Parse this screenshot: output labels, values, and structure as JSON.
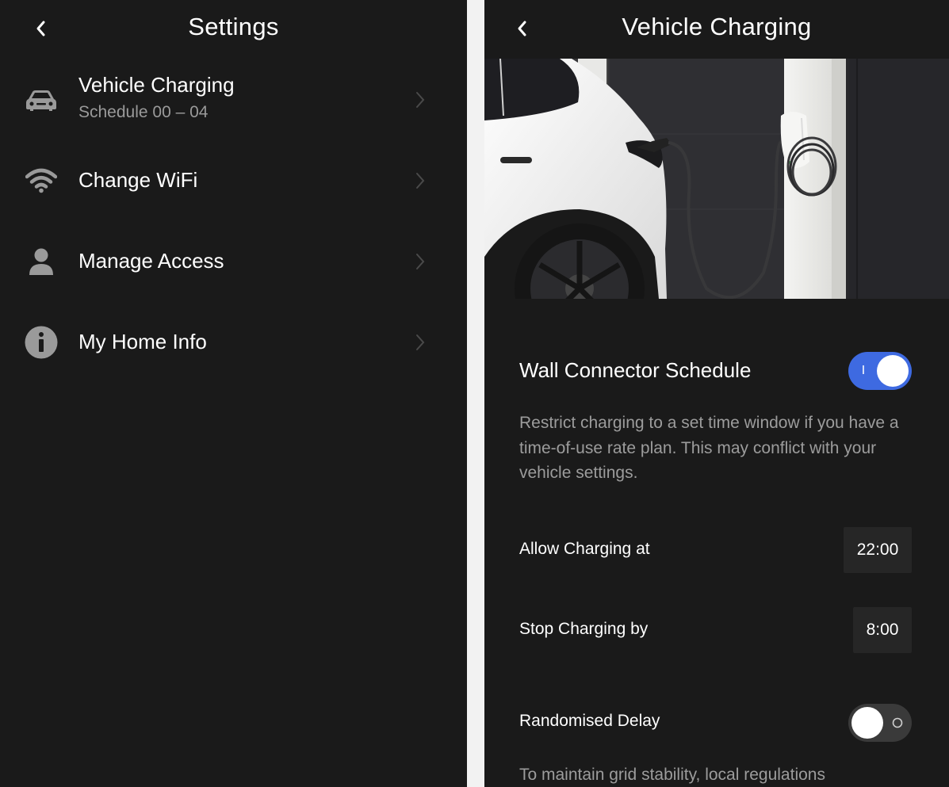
{
  "settings_screen": {
    "title": "Settings",
    "items": [
      {
        "label": "Vehicle Charging",
        "sublabel": "Schedule 00 – 04",
        "icon": "car-icon"
      },
      {
        "label": "Change WiFi",
        "icon": "wifi-icon"
      },
      {
        "label": "Manage Access",
        "icon": "person-icon"
      },
      {
        "label": "My Home Info",
        "icon": "info-icon"
      }
    ]
  },
  "charging_screen": {
    "title": "Vehicle Charging",
    "hero_image": "car-charging-photo",
    "schedule": {
      "title": "Wall Connector Schedule",
      "enabled": true,
      "toggle_on_mark": "I",
      "description": "Restrict charging to a set time window if you have a time-of-use rate plan. This may conflict with your vehicle settings."
    },
    "allow_charging": {
      "label": "Allow Charging at",
      "value": "22:00"
    },
    "stop_charging": {
      "label": "Stop Charging by",
      "value": "8:00"
    },
    "random_delay": {
      "label": "Randomised Delay",
      "enabled": false,
      "toggle_off_mark": "O",
      "description": "To maintain grid stability, local regulations"
    }
  },
  "colors": {
    "background": "#1a1a1a",
    "accent_blue": "#3e6ae1",
    "secondary_text": "#9a9a9a",
    "divider": "#f2f2f2"
  }
}
